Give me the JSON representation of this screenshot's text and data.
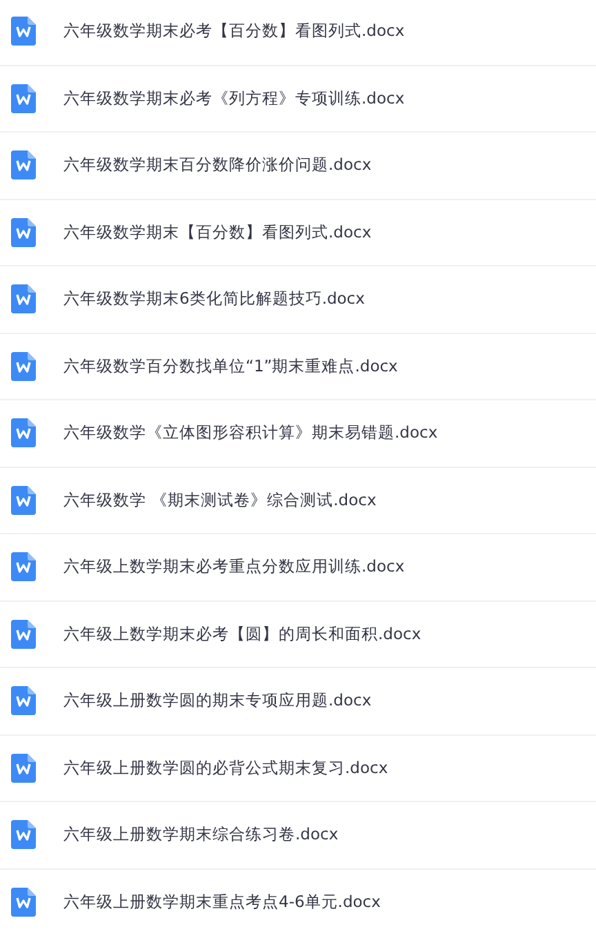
{
  "files": [
    {
      "name": "六年级数学期末必考【百分数】看图列式.docx",
      "kind": "docx"
    },
    {
      "name": "六年级数学期末必考《列方程》专项训练.docx",
      "kind": "docx"
    },
    {
      "name": "六年级数学期末百分数降价涨价问题.docx",
      "kind": "docx"
    },
    {
      "name": "六年级数学期末【百分数】看图列式.docx",
      "kind": "docx"
    },
    {
      "name": "六年级数学期末6类化简比解题技巧.docx",
      "kind": "docx"
    },
    {
      "name": "六年级数学百分数找单位“1”期末重难点.docx",
      "kind": "docx"
    },
    {
      "name": "六年级数学《立体图形容积计算》期末易错题.docx",
      "kind": "docx"
    },
    {
      "name": "六年级数学 《期末测试卷》综合测试.docx",
      "kind": "docx"
    },
    {
      "name": "六年级上数学期末必考重点分数应用训练.docx",
      "kind": "docx"
    },
    {
      "name": "六年级上数学期末必考【圆】的周长和面积.docx",
      "kind": "docx"
    },
    {
      "name": "六年级上册数学圆的期末专项应用题.docx",
      "kind": "docx"
    },
    {
      "name": "六年级上册数学圆的必背公式期末复习.docx",
      "kind": "docx"
    },
    {
      "name": "六年级上册数学期末综合练习卷.docx",
      "kind": "docx"
    },
    {
      "name": "六年级上册数学期末重点考点4-6单元.docx",
      "kind": "docx"
    }
  ]
}
